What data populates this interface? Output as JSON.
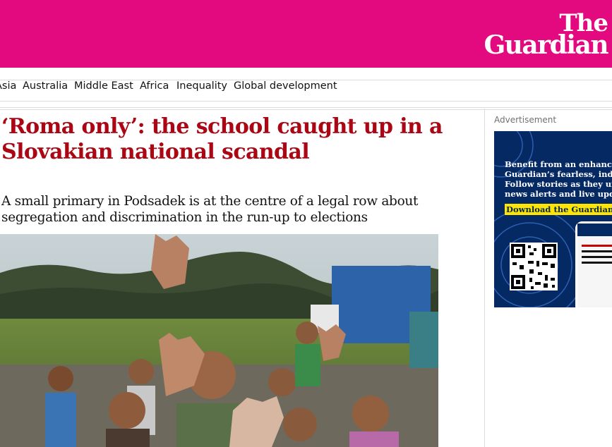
{
  "masthead": {
    "logo_line1": "The",
    "logo_line2": "Guardian",
    "brand_color": "#e20a7e"
  },
  "nav": {
    "items": [
      "Asia",
      "Australia",
      "Middle East",
      "Africa",
      "Inequality",
      "Global development"
    ]
  },
  "article": {
    "headline": "‘Roma only’: the school caught up in a Slovakian national scandal",
    "standfirst": "A small primary in Podsadek is at the centre of a legal row about segregation and discrimination in the run-up to elections",
    "headline_color": "#ab0613"
  },
  "advert": {
    "label": "Advertisement",
    "line1": "Benefit from an enhanced ex",
    "line2": "Guardian’s fearless, indepen",
    "line3": "Follow stories as they unfold",
    "line4": "news alerts and live updates.",
    "cta": "Download the Guardian app",
    "bg_color": "#052962",
    "cta_color": "#ffe500"
  }
}
